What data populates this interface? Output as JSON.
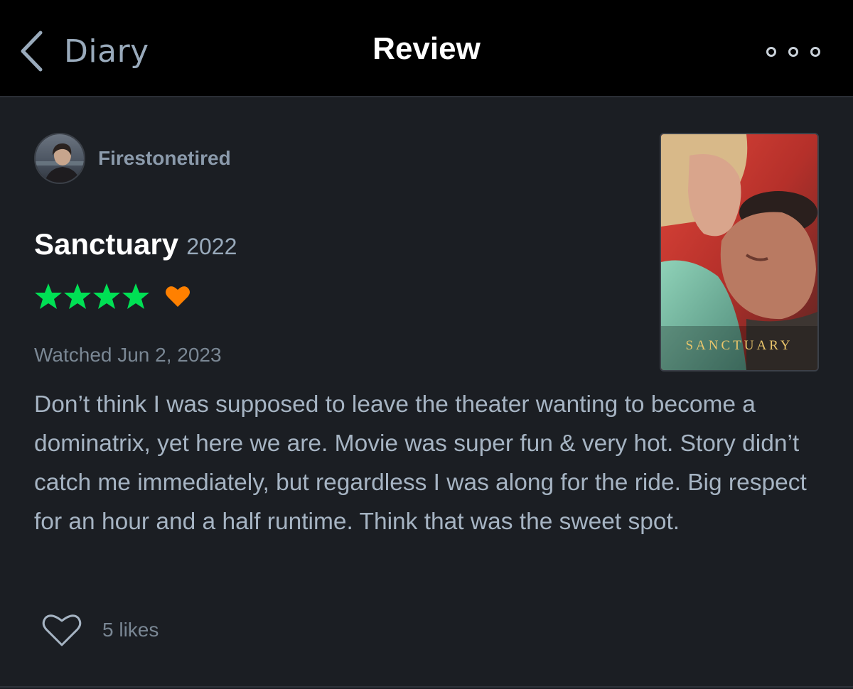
{
  "nav": {
    "back_label": "Diary",
    "title": "Review",
    "more_icon": "ellipsis-icon"
  },
  "reviewer": {
    "username": "Firestonetired",
    "avatar_icon": "avatar"
  },
  "film": {
    "title": "Sanctuary",
    "year": "2022",
    "rating_stars": 4,
    "rating_max": 5,
    "liked": true,
    "poster_title": "SANCTUARY"
  },
  "review": {
    "watched": "Watched Jun 2, 2023",
    "text": "Don’t think I was supposed to leave the theater wanting to become a dominatrix, yet here we are. Movie was super fun & very hot. Story didn’t catch me immediately, but regardless I was along for the ride. Big respect for an hour and a half runtime. Think that was the sweet spot."
  },
  "likes": {
    "label": "5 likes"
  },
  "colors": {
    "background": "#1b1e23",
    "navbar": "#000000",
    "star_green": "#00e054",
    "heart_orange": "#ff8000",
    "muted_text": "#99aabb"
  }
}
